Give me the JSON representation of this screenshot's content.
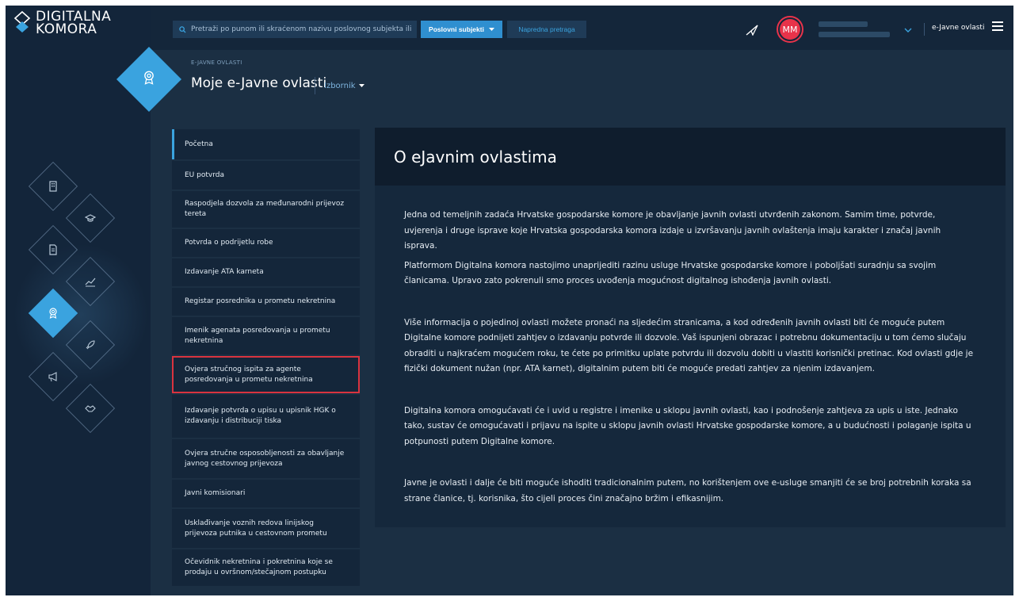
{
  "brand": {
    "line1": "DIGITALNA",
    "line2": "KOMORA"
  },
  "topbar": {
    "search_placeholder": "Pretraži po punom ili skraćenom nazivu poslovnog subjekta ili po OIB-u",
    "subjects_button": "Poslovni subjekti",
    "advanced_search": "Napredna pretraga",
    "avatar_initials": "MM",
    "module_label": "e-Javne ovlasti"
  },
  "header": {
    "section_label": "E-JAVNE OVLASTI",
    "title": "Moje e-Javne ovlasti",
    "menu_label": "Izbornik"
  },
  "menu": {
    "items": [
      {
        "label": "Početna"
      },
      {
        "label": "EU potvrda"
      },
      {
        "label": "Raspodjela dozvola za međunarodni prijevoz tereta"
      },
      {
        "label": "Potvrda o podrijetlu robe"
      },
      {
        "label": "Izdavanje ATA karneta"
      },
      {
        "label": "Registar posrednika u prometu nekretnina"
      },
      {
        "label": "Imenik agenata posredovanja u prometu nekretnina"
      },
      {
        "label": "Ovjera stručnog ispita za agente posredovanja u prometu nekretnina"
      },
      {
        "label": "Izdavanje potvrda o upisu u upisnik HGK o izdavanju i distribuciji tiska"
      },
      {
        "label": "Ovjera stručne osposobljenosti za obavljanje javnog cestovnog prijevoza"
      },
      {
        "label": "Javni komisionari"
      },
      {
        "label": "Usklađivanje voznih redova linijskog prijevoza putnika u cestovnom prometu"
      },
      {
        "label": "Očevidnik nekretnina i pokretnina koje se prodaju u ovršnom/stečajnom postupku"
      }
    ]
  },
  "content": {
    "title": "O eJavnim ovlastima",
    "paragraphs": [
      "Jedna od temeljnih zadaća Hrvatske gospodarske komore je obavljanje javnih ovlasti utvrđenih zakonom. Samim time, potvrde, uvjerenja i druge isprave koje Hrvatska gospodarska komora izdaje u izvršavanju javnih ovlaštenja imaju karakter i značaj javnih isprava.",
      "Platformom Digitalna komora nastojimo unaprijediti razinu usluge Hrvatske gospodarske komore i poboljšati suradnju sa svojim članicama. Upravo zato pokrenuli smo proces uvođenja mogućnost digitalnog ishođenja javnih ovlasti.",
      "Više informacija o pojedinoj ovlasti možete pronaći na sljedećim stranicama, a kod određenih javnih ovlasti biti će moguće putem Digitalne komore podnijeti zahtjev o izdavanju potvrde ili dozvole. Vaš ispunjeni obrazac i potrebnu dokumentaciju u tom ćemo slučaju obraditi u najkraćem mogućem roku, te ćete po primitku uplate potvrdu ili dozvolu dobiti u vlastiti korisnički pretinac. Kod ovlasti gdje je fizički dokument nužan (npr. ATA karnet), digitalnim putem biti će moguće predati zahtjev za njenim izdavanjem.",
      "Digitalna komora omogućavati će i uvid u registre i imenike u sklopu javnih ovlasti, kao i podnošenje zahtjeva za upis u iste. Jednako tako, sustav će omogućavati i prijavu na ispite u sklopu javnih ovlasti Hrvatske gospodarske komore, a u budućnosti i polaganje ispita u potpunosti putem Digitalne komore.",
      "Javne je ovlasti i dalje će biti moguće ishoditi tradicionalnim putem, no korištenjem ove e-usluge smanjiti će se broj potrebnih koraka sa strane članice, tj. korisnika, što cijeli proces čini značajno bržim i efikasnijim."
    ]
  },
  "colors": {
    "accent": "#3aa3df",
    "background": "#1b2f43",
    "avatar": "#e8334a",
    "highlight_box": "#d9333f"
  },
  "side_icons": [
    "building-icon",
    "graduation-cap-icon",
    "document-icon",
    "chart-icon",
    "award-icon",
    "rocket-icon",
    "megaphone-icon",
    "handshake-icon"
  ]
}
